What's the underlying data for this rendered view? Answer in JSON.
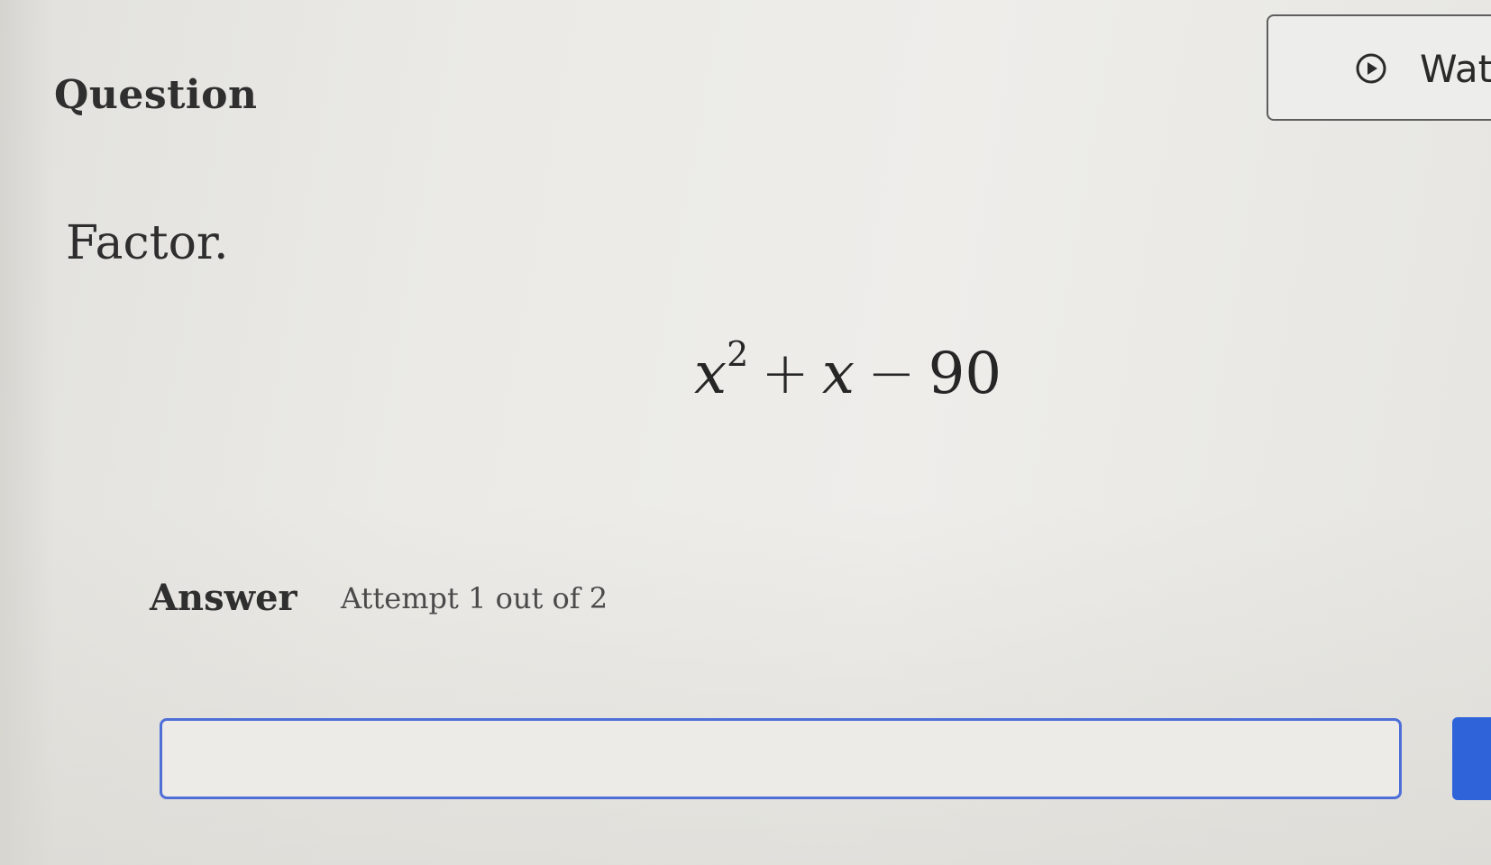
{
  "question": {
    "title": "Question",
    "prompt": "Factor."
  },
  "watch_button": {
    "label": "Wat",
    "icon": "play-circle-icon"
  },
  "expression": {
    "base": "x",
    "exponent": "2",
    "op1": "+",
    "term2": "x",
    "op2": "−",
    "constant": "90"
  },
  "answer": {
    "label": "Answer",
    "attempt": "Attempt 1 out of 2",
    "input_value": ""
  },
  "colors": {
    "input_border": "#4f6fd8",
    "submit_button": "#2f63d9"
  }
}
